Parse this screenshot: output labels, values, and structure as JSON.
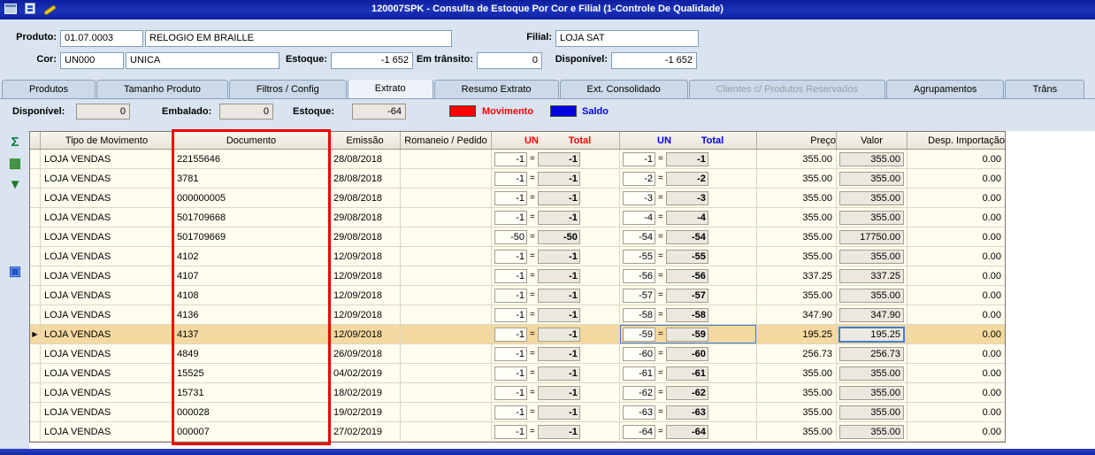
{
  "titlebar": {
    "title": "120007SPK - Consulta de Estoque Por Cor e Filial (1-Controle De Qualidade)",
    "icons": [
      "window-icon",
      "app-icon",
      "wrench-icon"
    ]
  },
  "form": {
    "produto_label": "Produto:",
    "produto_code": "01.07.0003",
    "produto_name": "RELOGIO EM BRAILLE",
    "filial_label": "Filial:",
    "filial_value": "LOJA SAT",
    "cor_label": "Cor:",
    "cor_code": "UN000",
    "cor_name": "UNICA",
    "estoque_label": "Estoque:",
    "estoque_value": "-1 652",
    "transito_label": "Em trânsito:",
    "transito_value": "0",
    "disponivel_label": "Disponível:",
    "disponivel_value": "-1 652"
  },
  "tabs": [
    {
      "label": "Produtos"
    },
    {
      "label": "Tamanho Produto"
    },
    {
      "label": "Filtros / Config"
    },
    {
      "label": "Extrato",
      "active": true
    },
    {
      "label": "Resumo Extrato"
    },
    {
      "label": "Ext. Consolidado"
    },
    {
      "label": "Clientes c/ Produtos Reservados",
      "disabled": true
    },
    {
      "label": "Agrupamentos"
    },
    {
      "label": "Trâns"
    }
  ],
  "summary": {
    "disponivel_label": "Disponível:",
    "disponivel_value": "0",
    "embalado_label": "Embalado:",
    "embalado_value": "0",
    "estoque_label": "Estoque:",
    "estoque_value": "-64",
    "legend": {
      "movimento_label": "Movimento",
      "movimento_color": "#ff0000",
      "saldo_label": "Saldo",
      "saldo_color": "#0000e0"
    }
  },
  "side_icons": [
    {
      "name": "sigma-icon",
      "glyph": "Σ",
      "color": "#0c7a40"
    },
    {
      "name": "export-grid-icon",
      "glyph": "▦",
      "color": "#2e8b2e"
    },
    {
      "name": "download-icon",
      "glyph": "▼",
      "color": "#1f7a1f"
    },
    {
      "name": "image-icon",
      "glyph": "▣",
      "color": "#2255cc"
    }
  ],
  "grid": {
    "headers": {
      "tipo": "Tipo de Movimento",
      "documento": "Documento",
      "emissao": "Emissão",
      "romaneio": "Romaneio / Pedido",
      "mov_un": "UN",
      "mov_total": "Total",
      "saldo_un": "UN",
      "saldo_total": "Total",
      "preco": "Preço",
      "valor": "Valor",
      "desp": "Desp. Importação"
    },
    "rows": [
      {
        "marker": "",
        "tipo": "LOJA VENDAS",
        "documento": "22155646",
        "emissao": "28/08/2018",
        "romaneio": "",
        "mov_un": "-1",
        "mov_total": "-1",
        "saldo_un": "-1",
        "saldo_total": "-1",
        "preco": "355.00",
        "valor": "355.00",
        "desp": "0.00"
      },
      {
        "marker": "",
        "tipo": "LOJA VENDAS",
        "documento": "3781",
        "emissao": "28/08/2018",
        "romaneio": "",
        "mov_un": "-1",
        "mov_total": "-1",
        "saldo_un": "-2",
        "saldo_total": "-2",
        "preco": "355.00",
        "valor": "355.00",
        "desp": "0.00"
      },
      {
        "marker": "",
        "tipo": "LOJA VENDAS",
        "documento": "000000005",
        "emissao": "29/08/2018",
        "romaneio": "",
        "mov_un": "-1",
        "mov_total": "-1",
        "saldo_un": "-3",
        "saldo_total": "-3",
        "preco": "355.00",
        "valor": "355.00",
        "desp": "0.00"
      },
      {
        "marker": "",
        "tipo": "LOJA VENDAS",
        "documento": "501709668",
        "emissao": "29/08/2018",
        "romaneio": "",
        "mov_un": "-1",
        "mov_total": "-1",
        "saldo_un": "-4",
        "saldo_total": "-4",
        "preco": "355.00",
        "valor": "355.00",
        "desp": "0.00"
      },
      {
        "marker": "",
        "tipo": "LOJA VENDAS",
        "documento": "501709669",
        "emissao": "29/08/2018",
        "romaneio": "",
        "mov_un": "-50",
        "mov_total": "-50",
        "saldo_un": "-54",
        "saldo_total": "-54",
        "preco": "355.00",
        "valor": "17750.00",
        "desp": "0.00"
      },
      {
        "marker": "",
        "tipo": "LOJA VENDAS",
        "documento": "4102",
        "emissao": "12/09/2018",
        "romaneio": "",
        "mov_un": "-1",
        "mov_total": "-1",
        "saldo_un": "-55",
        "saldo_total": "-55",
        "preco": "355.00",
        "valor": "355.00",
        "desp": "0.00"
      },
      {
        "marker": "",
        "tipo": "LOJA VENDAS",
        "documento": "4107",
        "emissao": "12/09/2018",
        "romaneio": "",
        "mov_un": "-1",
        "mov_total": "-1",
        "saldo_un": "-56",
        "saldo_total": "-56",
        "preco": "337.25",
        "valor": "337.25",
        "desp": "0.00"
      },
      {
        "marker": "",
        "tipo": "LOJA VENDAS",
        "documento": "4108",
        "emissao": "12/09/2018",
        "romaneio": "",
        "mov_un": "-1",
        "mov_total": "-1",
        "saldo_un": "-57",
        "saldo_total": "-57",
        "preco": "355.00",
        "valor": "355.00",
        "desp": "0.00"
      },
      {
        "marker": "",
        "tipo": "LOJA VENDAS",
        "documento": "4136",
        "emissao": "12/09/2018",
        "romaneio": "",
        "mov_un": "-1",
        "mov_total": "-1",
        "saldo_un": "-58",
        "saldo_total": "-58",
        "preco": "347.90",
        "valor": "347.90",
        "desp": "0.00"
      },
      {
        "marker": "▶",
        "selected": true,
        "tipo": "LOJA VENDAS",
        "documento": "4137",
        "emissao": "12/09/2018",
        "romaneio": "",
        "mov_un": "-1",
        "mov_total": "-1",
        "saldo_un": "-59",
        "saldo_total": "-59",
        "preco": "195.25",
        "valor": "195.25",
        "desp": "0.00"
      },
      {
        "marker": "",
        "tipo": "LOJA VENDAS",
        "documento": "4849",
        "emissao": "26/09/2018",
        "romaneio": "",
        "mov_un": "-1",
        "mov_total": "-1",
        "saldo_un": "-60",
        "saldo_total": "-60",
        "preco": "256.73",
        "valor": "256.73",
        "desp": "0.00"
      },
      {
        "marker": "",
        "tipo": "LOJA VENDAS",
        "documento": "15525",
        "emissao": "04/02/2019",
        "romaneio": "",
        "mov_un": "-1",
        "mov_total": "-1",
        "saldo_un": "-61",
        "saldo_total": "-61",
        "preco": "355.00",
        "valor": "355.00",
        "desp": "0.00"
      },
      {
        "marker": "",
        "tipo": "LOJA VENDAS",
        "documento": "15731",
        "emissao": "18/02/2019",
        "romaneio": "",
        "mov_un": "-1",
        "mov_total": "-1",
        "saldo_un": "-62",
        "saldo_total": "-62",
        "preco": "355.00",
        "valor": "355.00",
        "desp": "0.00"
      },
      {
        "marker": "",
        "tipo": "LOJA VENDAS",
        "documento": "000028",
        "emissao": "19/02/2019",
        "romaneio": "",
        "mov_un": "-1",
        "mov_total": "-1",
        "saldo_un": "-63",
        "saldo_total": "-63",
        "preco": "355.00",
        "valor": "355.00",
        "desp": "0.00"
      },
      {
        "marker": "",
        "tipo": "LOJA VENDAS",
        "documento": "000007",
        "emissao": "27/02/2019",
        "romaneio": "",
        "mov_un": "-1",
        "mov_total": "-1",
        "saldo_un": "-64",
        "saldo_total": "-64",
        "preco": "355.00",
        "valor": "355.00",
        "desp": "0.00"
      }
    ]
  }
}
